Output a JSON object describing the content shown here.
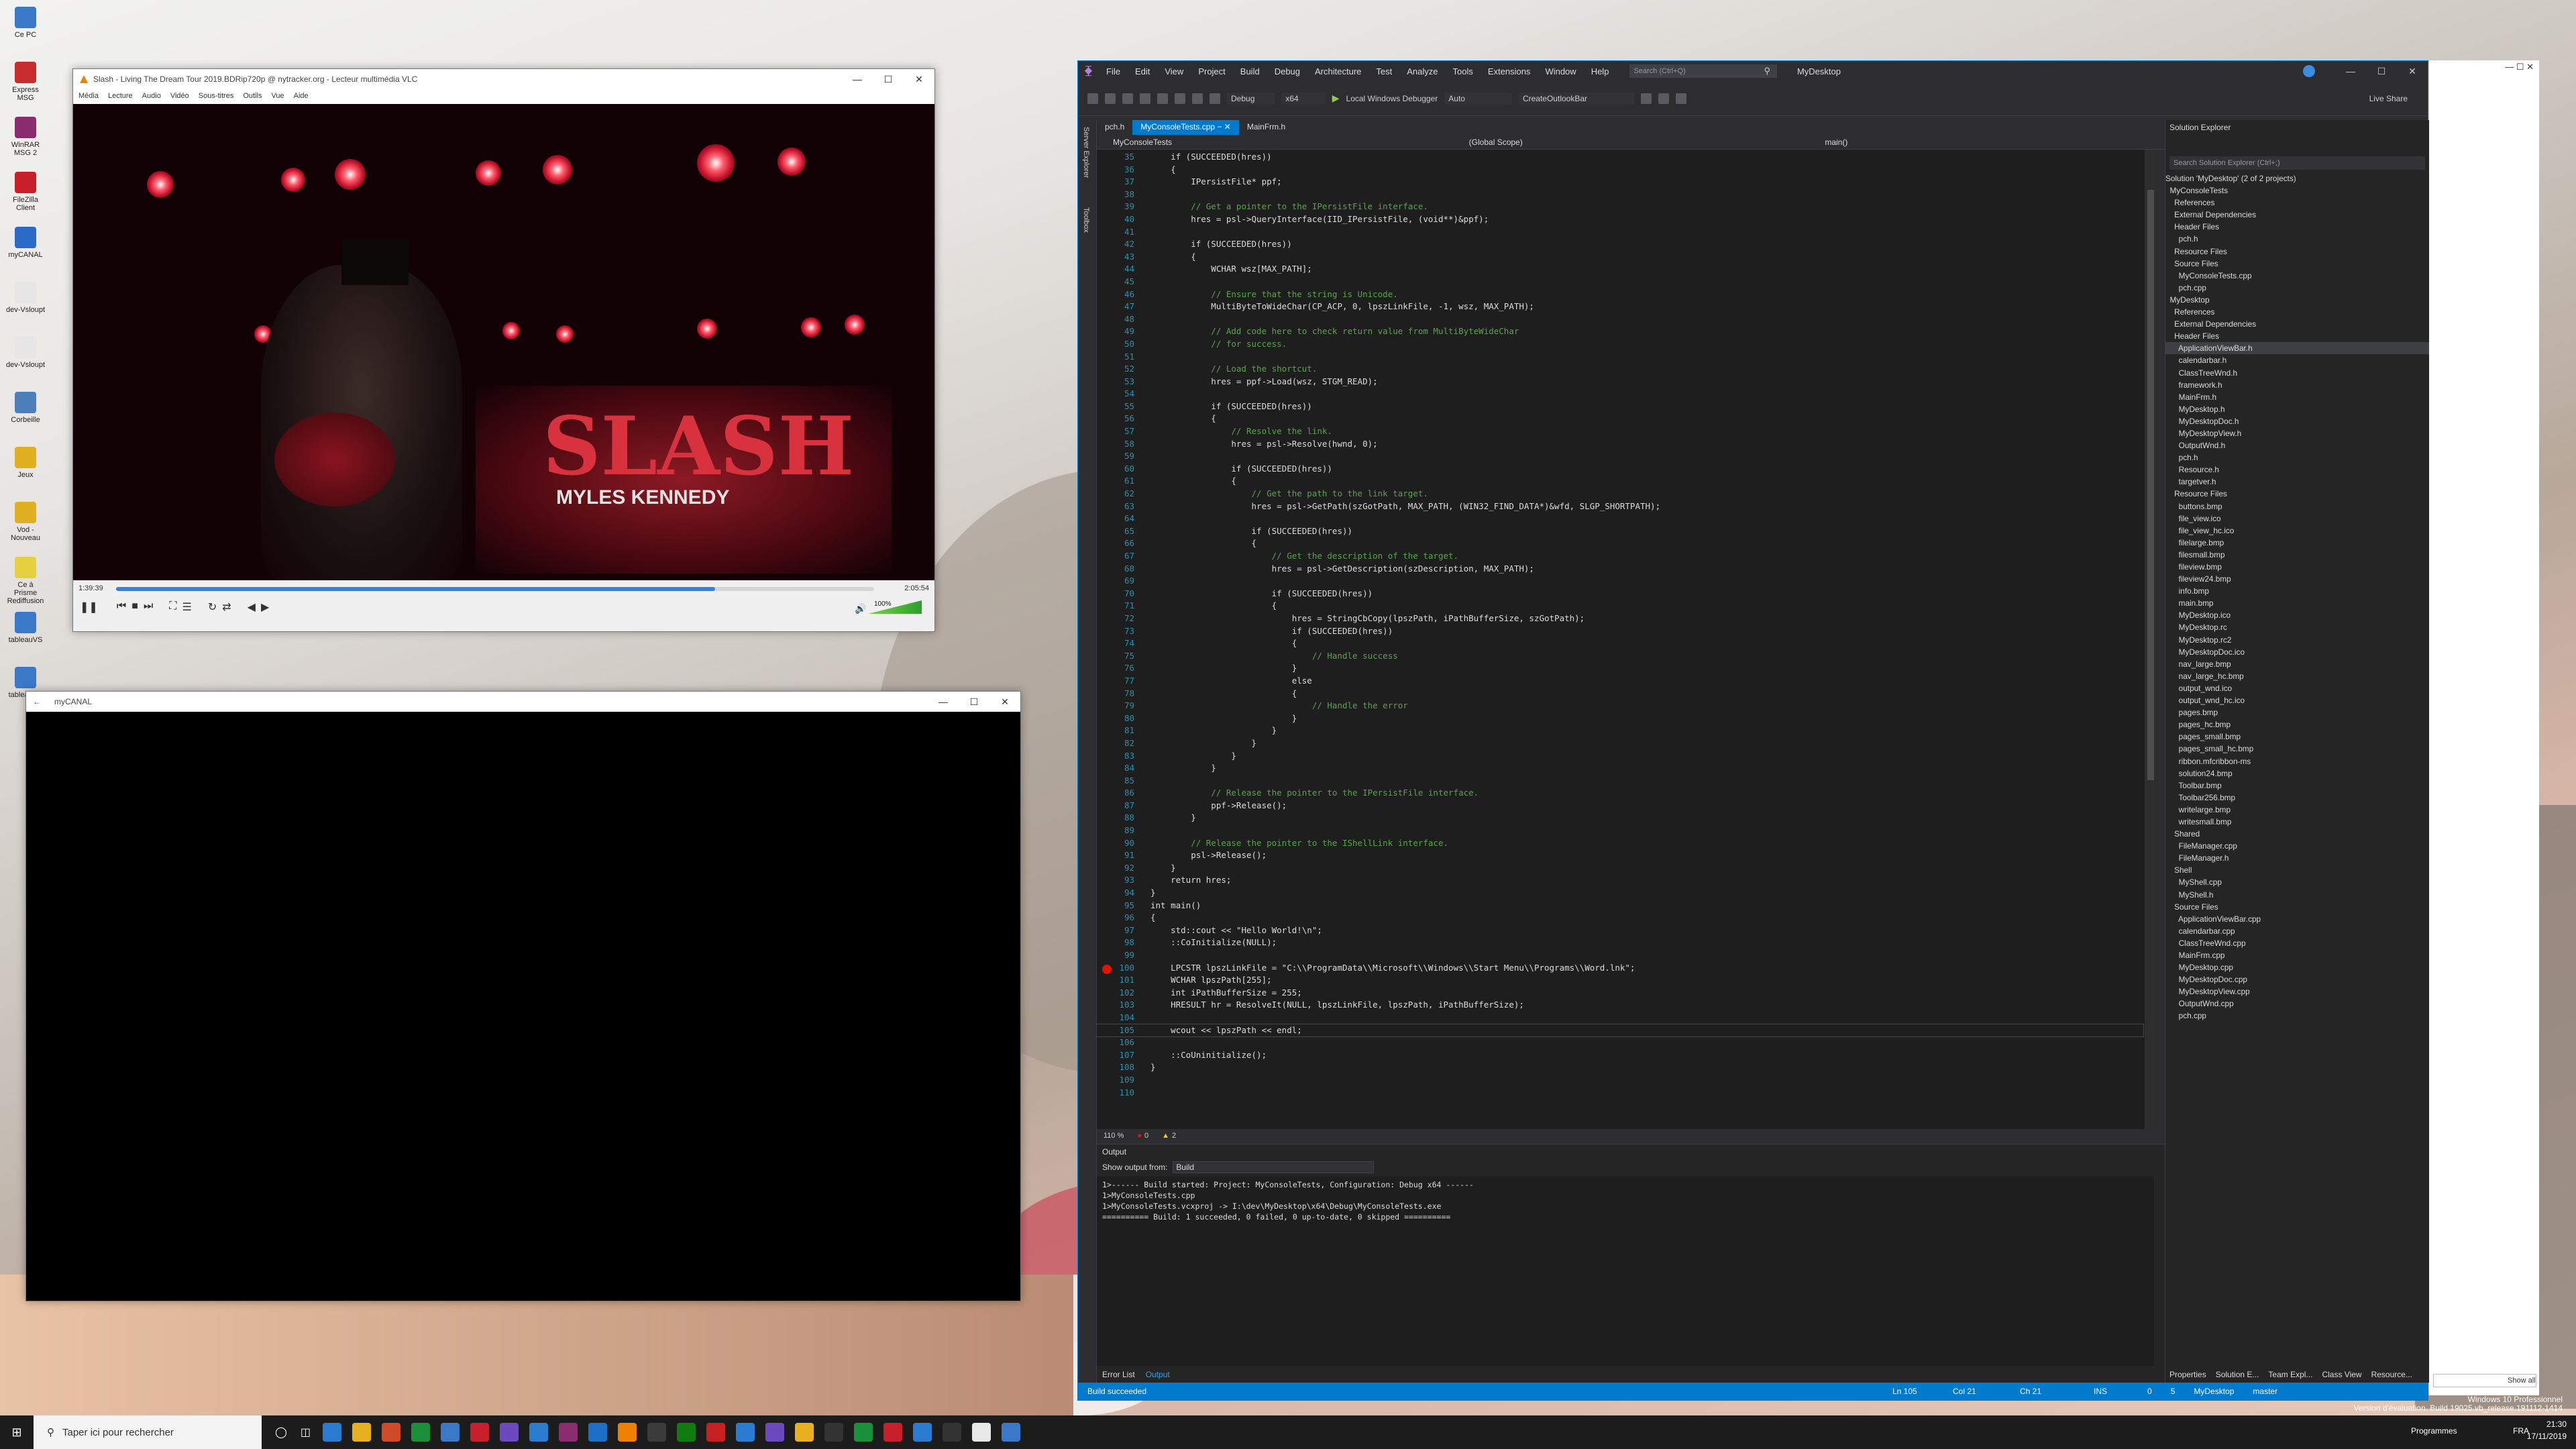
{
  "desktop": {
    "icons": [
      {
        "label": "Ce PC",
        "color": "#3b78c8"
      },
      {
        "label": "Express MSG",
        "color": "#c92d2d"
      },
      {
        "label": "WinRAR MSG 2",
        "color": "#8a2c6e"
      },
      {
        "label": "FileZilla Client",
        "color": "#c8202a"
      },
      {
        "label": "myCANAL",
        "color": "#2c6ac8"
      },
      {
        "label": "dev-Vsloupt",
        "color": "#e6e6e6"
      },
      {
        "label": "dev-Vsloupt",
        "color": "#e6e6e6"
      },
      {
        "label": "Corbeille",
        "color": "#4d7fb8"
      },
      {
        "label": "Jeux",
        "color": "#e0b020"
      },
      {
        "label": "Vod - Nouveau",
        "color": "#e0b020"
      },
      {
        "label": "Ce à Prisme Rediffusion",
        "color": "#e6d040"
      },
      {
        "label": "tableauVS",
        "color": "#3b78c8"
      },
      {
        "label": "tableauVS",
        "color": "#3b78c8"
      }
    ]
  },
  "vlc": {
    "title": "Slash - Living The Dream Tour 2019.BDRip720p @ nytracker.org - Lecteur multimédia VLC",
    "menu": [
      "Média",
      "Lecture",
      "Audio",
      "Vidéo",
      "Sous-titres",
      "Outils",
      "Vue",
      "Aide"
    ],
    "time_elapsed": "1:39:39",
    "time_total": "2:05:54",
    "progress": 0.79,
    "volume": "100%",
    "banner_text": "SLASH",
    "banner_sub": "MYLES KENNEDY"
  },
  "canal": {
    "title": "myCANAL"
  },
  "vs": {
    "menu": [
      "File",
      "Edit",
      "View",
      "Project",
      "Build",
      "Debug",
      "Architecture",
      "Test",
      "Analyze",
      "Tools",
      "Extensions",
      "Window",
      "Help"
    ],
    "search_placeholder": "Search (Ctrl+Q)",
    "solution_name": "MyDesktop",
    "live_share": "Live Share",
    "toolbar": {
      "config": "Debug",
      "platform": "x64",
      "debugger": "Local Windows Debugger",
      "auto": "Auto",
      "target": "CreateOutlookBar"
    },
    "tabs": [
      "pch.h",
      "MyConsoleTests.cpp",
      "MainFrm.h"
    ],
    "nav": {
      "project": "MyConsoleTests",
      "scope": "(Global Scope)",
      "member": "main()"
    },
    "side_tabs": [
      "Server Explorer",
      "Toolbox"
    ],
    "code_lines": [
      {
        "n": "35",
        "t": "    if (SUCCEEDED(hres))"
      },
      {
        "n": "36",
        "t": "    {"
      },
      {
        "n": "37",
        "t": "        IPersistFile* ppf;"
      },
      {
        "n": "38",
        "t": ""
      },
      {
        "n": "39",
        "t": "        // Get a pointer to the IPersistFile interface."
      },
      {
        "n": "40",
        "t": "        hres = psl->QueryInterface(IID_IPersistFile, (void**)&ppf);"
      },
      {
        "n": "41",
        "t": ""
      },
      {
        "n": "42",
        "t": "        if (SUCCEEDED(hres))"
      },
      {
        "n": "43",
        "t": "        {"
      },
      {
        "n": "44",
        "t": "            WCHAR wsz[MAX_PATH];"
      },
      {
        "n": "45",
        "t": ""
      },
      {
        "n": "46",
        "t": "            // Ensure that the string is Unicode."
      },
      {
        "n": "47",
        "t": "            MultiByteToWideChar(CP_ACP, 0, lpszLinkFile, -1, wsz, MAX_PATH);"
      },
      {
        "n": "48",
        "t": ""
      },
      {
        "n": "49",
        "t": "            // Add code here to check return value from MultiByteWideChar"
      },
      {
        "n": "50",
        "t": "            // for success."
      },
      {
        "n": "51",
        "t": ""
      },
      {
        "n": "52",
        "t": "            // Load the shortcut."
      },
      {
        "n": "53",
        "t": "            hres = ppf->Load(wsz, STGM_READ);"
      },
      {
        "n": "54",
        "t": ""
      },
      {
        "n": "55",
        "t": "            if (SUCCEEDED(hres))"
      },
      {
        "n": "56",
        "t": "            {"
      },
      {
        "n": "57",
        "t": "                // Resolve the link."
      },
      {
        "n": "58",
        "t": "                hres = psl->Resolve(hwnd, 0);"
      },
      {
        "n": "59",
        "t": ""
      },
      {
        "n": "60",
        "t": "                if (SUCCEEDED(hres))"
      },
      {
        "n": "61",
        "t": "                {"
      },
      {
        "n": "62",
        "t": "                    // Get the path to the link target."
      },
      {
        "n": "63",
        "t": "                    hres = psl->GetPath(szGotPath, MAX_PATH, (WIN32_FIND_DATA*)&wfd, SLGP_SHORTPATH);"
      },
      {
        "n": "64",
        "t": ""
      },
      {
        "n": "65",
        "t": "                    if (SUCCEEDED(hres))"
      },
      {
        "n": "66",
        "t": "                    {"
      },
      {
        "n": "67",
        "t": "                        // Get the description of the target."
      },
      {
        "n": "68",
        "t": "                        hres = psl->GetDescription(szDescription, MAX_PATH);"
      },
      {
        "n": "69",
        "t": ""
      },
      {
        "n": "70",
        "t": "                        if (SUCCEEDED(hres))"
      },
      {
        "n": "71",
        "t": "                        {"
      },
      {
        "n": "72",
        "t": "                            hres = StringCbCopy(lpszPath, iPathBufferSize, szGotPath);"
      },
      {
        "n": "73",
        "t": "                            if (SUCCEEDED(hres))"
      },
      {
        "n": "74",
        "t": "                            {"
      },
      {
        "n": "75",
        "t": "                                // Handle success"
      },
      {
        "n": "76",
        "t": "                            }"
      },
      {
        "n": "77",
        "t": "                            else"
      },
      {
        "n": "78",
        "t": "                            {"
      },
      {
        "n": "79",
        "t": "                                // Handle the error"
      },
      {
        "n": "80",
        "t": "                            }"
      },
      {
        "n": "81",
        "t": "                        }"
      },
      {
        "n": "82",
        "t": "                    }"
      },
      {
        "n": "83",
        "t": "                }"
      },
      {
        "n": "84",
        "t": "            }"
      },
      {
        "n": "85",
        "t": ""
      },
      {
        "n": "86",
        "t": "            // Release the pointer to the IPersistFile interface."
      },
      {
        "n": "87",
        "t": "            ppf->Release();"
      },
      {
        "n": "88",
        "t": "        }"
      },
      {
        "n": "89",
        "t": ""
      },
      {
        "n": "90",
        "t": "        // Release the pointer to the IShellLink interface."
      },
      {
        "n": "91",
        "t": "        psl->Release();"
      },
      {
        "n": "92",
        "t": "    }"
      },
      {
        "n": "93",
        "t": "    return hres;"
      },
      {
        "n": "94",
        "t": "}"
      },
      {
        "n": "95",
        "t": "int main()"
      },
      {
        "n": "96",
        "t": "{"
      },
      {
        "n": "97",
        "t": "    std::cout << \"Hello World!\\n\";"
      },
      {
        "n": "98",
        "t": "    ::CoInitialize(NULL);"
      },
      {
        "n": "99",
        "t": ""
      },
      {
        "n": "100",
        "t": "    LPCSTR lpszLinkFile = \"C:\\\\ProgramData\\\\Microsoft\\\\Windows\\\\Start Menu\\\\Programs\\\\Word.lnk\";"
      },
      {
        "n": "101",
        "t": "    WCHAR lpszPath[255];"
      },
      {
        "n": "102",
        "t": "    int iPathBufferSize = 255;"
      },
      {
        "n": "103",
        "t": "    HRESULT hr = ResolveIt(NULL, lpszLinkFile, lpszPath, iPathBufferSize);"
      },
      {
        "n": "104",
        "t": ""
      },
      {
        "n": "105",
        "t": "    wcout << lpszPath << endl;"
      },
      {
        "n": "106",
        "t": ""
      },
      {
        "n": "107",
        "t": "    ::CoUninitialize();"
      },
      {
        "n": "108",
        "t": "}"
      },
      {
        "n": "109",
        "t": ""
      },
      {
        "n": "110",
        "t": ""
      }
    ],
    "breakpoint_line": "100",
    "current_line": "105",
    "zoom": "110 %",
    "errors": "0",
    "warnings": "2",
    "output": {
      "title": "Output",
      "show_from_label": "Show output from:",
      "show_from_value": "Build",
      "text": "1>------ Build started: Project: MyConsoleTests, Configuration: Debug x64 ------\n1>MyConsoleTests.cpp\n1>MyConsoleTests.vcxproj -> I:\\dev\\MyDesktop\\x64\\Debug\\MyConsoleTests.exe\n========== Build: 1 succeeded, 0 failed, 0 up-to-date, 0 skipped ==========",
      "tabs": [
        "Error List",
        "Output"
      ]
    },
    "solution_explorer": {
      "title": "Solution Explorer",
      "search_placeholder": "Search Solution Explorer (Ctrl+;)",
      "items": [
        "Solution 'MyDesktop' (2 of 2 projects)",
        "  MyConsoleTests",
        "    References",
        "    External Dependencies",
        "    Header Files",
        "      pch.h",
        "    Resource Files",
        "    Source Files",
        "      MyConsoleTests.cpp",
        "      pch.cpp",
        "  MyDesktop",
        "    References",
        "    External Dependencies",
        "    Header Files",
        "      ApplicationViewBar.h",
        "      calendarbar.h",
        "      ClassTreeWnd.h",
        "      framework.h",
        "      MainFrm.h",
        "      MyDesktop.h",
        "      MyDesktopDoc.h",
        "      MyDesktopView.h",
        "      OutputWnd.h",
        "      pch.h",
        "      Resource.h",
        "      targetver.h",
        "    Resource Files",
        "      buttons.bmp",
        "      file_view.ico",
        "      file_view_hc.ico",
        "      filelarge.bmp",
        "      filesmall.bmp",
        "      fileview.bmp",
        "      fileview24.bmp",
        "      info.bmp",
        "      main.bmp",
        "      MyDesktop.ico",
        "      MyDesktop.rc",
        "      MyDesktop.rc2",
        "      MyDesktopDoc.ico",
        "      nav_large.bmp",
        "      nav_large_hc.bmp",
        "      output_wnd.ico",
        "      output_wnd_hc.ico",
        "      pages.bmp",
        "      pages_hc.bmp",
        "      pages_small.bmp",
        "      pages_small_hc.bmp",
        "      ribbon.mfcribbon-ms",
        "      solution24.bmp",
        "      Toolbar.bmp",
        "      Toolbar256.bmp",
        "      writelarge.bmp",
        "      writesmall.bmp",
        "    Shared",
        "      FileManager.cpp",
        "      FileManager.h",
        "    Shell",
        "      MyShell.cpp",
        "      MyShell.h",
        "    Source Files",
        "      ApplicationViewBar.cpp",
        "      calendarbar.cpp",
        "      ClassTreeWnd.cpp",
        "      MainFrm.cpp",
        "      MyDesktop.cpp",
        "      MyDesktopDoc.cpp",
        "      MyDesktopView.cpp",
        "      OutputWnd.cpp",
        "      pch.cpp"
      ],
      "highlighted": "      ApplicationViewBar.h",
      "tabs": [
        "Properties",
        "Solution E...",
        "Team Expl...",
        "Class View",
        "Resource..."
      ]
    },
    "status": {
      "msg": "Build succeeded",
      "ln": "Ln 105",
      "col": "Col 21",
      "ch": "Ch 21",
      "ins": "INS",
      "up": "0",
      "pencil": "5",
      "repo": "MyDesktop",
      "branch": "master"
    }
  },
  "taskbar": {
    "search_placeholder": "Taper ici pour rechercher",
    "programmes": "Programmes",
    "lang": "FRA",
    "time": "21:30",
    "date": "17/11/2019",
    "watermark1": "Windows 10 Professionnel",
    "watermark2": "Version d'évaluation. Build 19025.vb_release.191112-1414",
    "show_all": "Show all"
  }
}
